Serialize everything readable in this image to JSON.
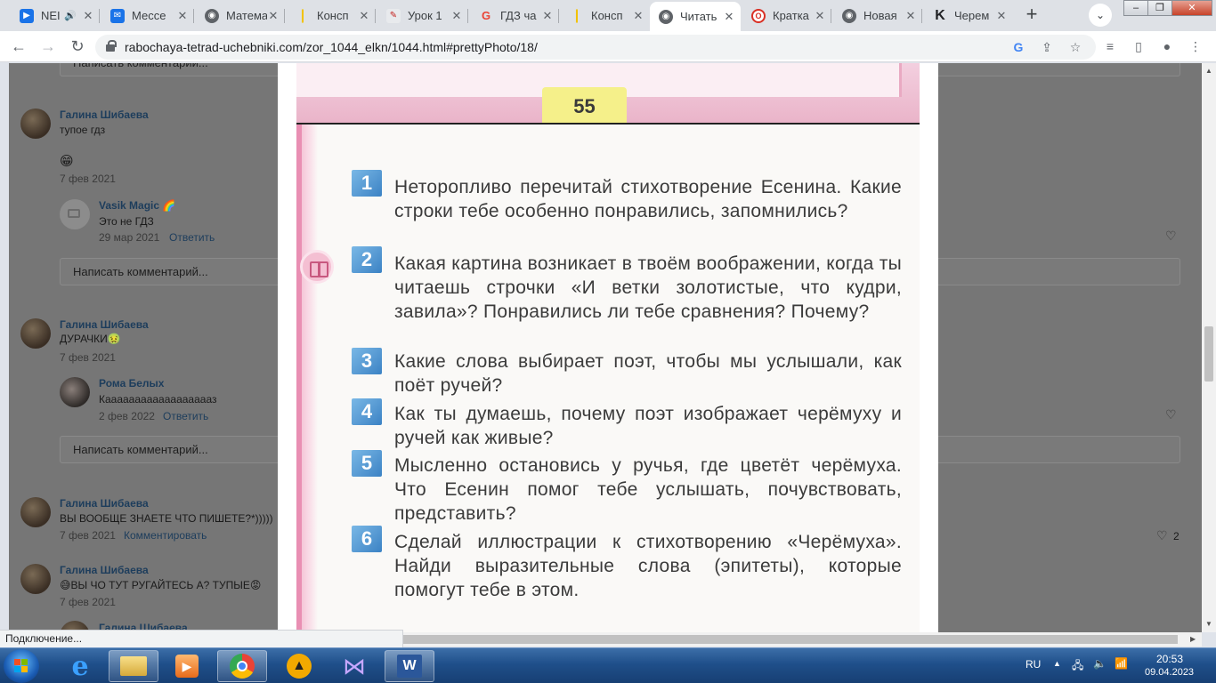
{
  "browser": {
    "tabs": [
      {
        "title": "NEI",
        "favicon": "youtube-icon",
        "color": "#1a73e8",
        "glyph": "▶"
      },
      {
        "title": "Мессе",
        "favicon": "messenger-icon",
        "color": "#1a73e8",
        "glyph": "✉"
      },
      {
        "title": "Матема",
        "favicon": "globe-icon",
        "color": "#5f6368",
        "glyph": "◉"
      },
      {
        "title": "Консп",
        "favicon": "yandex-zen-icon",
        "color": "#f2c200",
        "glyph": "|"
      },
      {
        "title": "Урок 1",
        "favicon": "pencil-icon",
        "color": "#e8eaed",
        "glyph": "✎"
      },
      {
        "title": "ГДЗ ча",
        "favicon": "gdz-icon",
        "color": "#ea4335",
        "glyph": "G"
      },
      {
        "title": "Консп",
        "favicon": "yandex-zen-icon",
        "color": "#f2c200",
        "glyph": "|"
      },
      {
        "title": "Читать",
        "favicon": "globe-icon",
        "color": "#5f6368",
        "glyph": "◉",
        "active": true
      },
      {
        "title": "Кратка",
        "favicon": "opera-icon",
        "color": "#d93025",
        "glyph": "O"
      },
      {
        "title": "Новая",
        "favicon": "globe-icon",
        "color": "#5f6368",
        "glyph": "◉"
      },
      {
        "title": "Черем",
        "favicon": "k-icon",
        "color": "#ffffff",
        "glyph": "K"
      }
    ],
    "url": "rabochaya-tetrad-uchebniki.com/zor_1044_elkn/1044.html#prettyPhoto/18/",
    "status": "Подключение..."
  },
  "comments": {
    "top_input_placeholder": "Написать комментарий...",
    "items": [
      {
        "author": "Галина Шибаева",
        "text": "тупое гдз",
        "emoji": "😁",
        "date": "7 фев 2021"
      },
      {
        "author": "Vasik Magic 🌈",
        "text": "Это не ГДЗ",
        "date": "29 мар 2021",
        "action": "Ответить"
      },
      {
        "author": "Галина Шибаева",
        "text": "ДУРАЧКИ🤢",
        "date": "7 фев 2021"
      },
      {
        "author": "Рома Белых",
        "text": "Кааааааааааааааааааз",
        "date": "2 фев 2022",
        "action": "Ответить"
      },
      {
        "author": "Галина Шибаева",
        "text": "ВЫ ВООБЩЕ ЗНАЕТЕ ЧТО ПИШЕТЕ?*)))))",
        "date": "7 фев 2021",
        "action": "Комментировать",
        "likes": "2"
      },
      {
        "author": "Галина Шибаева",
        "text": "😅ВЫ ЧО ТУТ РУГАЙТЕСЬ А? ТУПЫЕ😡",
        "date": "7 фев 2021"
      },
      {
        "author": "Галина Шибаева"
      }
    ],
    "input_placeholder": "Написать комментарий..."
  },
  "textbook": {
    "page_number": "55",
    "questions": [
      {
        "n": "1",
        "text": "Неторопливо перечитай стихотворение Есенина. Какие строки тебе особенно понравились, запомнились?"
      },
      {
        "n": "2",
        "text": "Какая картина возникает в твоём воображении, когда ты читаешь строчки «И ветки золотистые, что кудри, завила»? Понравились ли тебе сравнения? Почему?"
      },
      {
        "n": "3",
        "text": "Какие слова выбирает поэт, чтобы мы услышали, как поёт ручей?"
      },
      {
        "n": "4",
        "text": "Как ты думаешь, почему поэт изображает черёмуху и ручей как живые?"
      },
      {
        "n": "5",
        "text": "Мысленно остановись у ручья, где цветёт черёмуха. Что Есенин помог тебе услышать, почувствовать, представить?"
      },
      {
        "n": "6",
        "text": "Сделай иллюстрации к стихотворению «Черёмуха». Найди выразительные слова (эпитеты), которые помогут тебе в этом."
      }
    ]
  },
  "taskbar": {
    "lang": "RU",
    "time": "20:53",
    "date": "09.04.2023"
  }
}
